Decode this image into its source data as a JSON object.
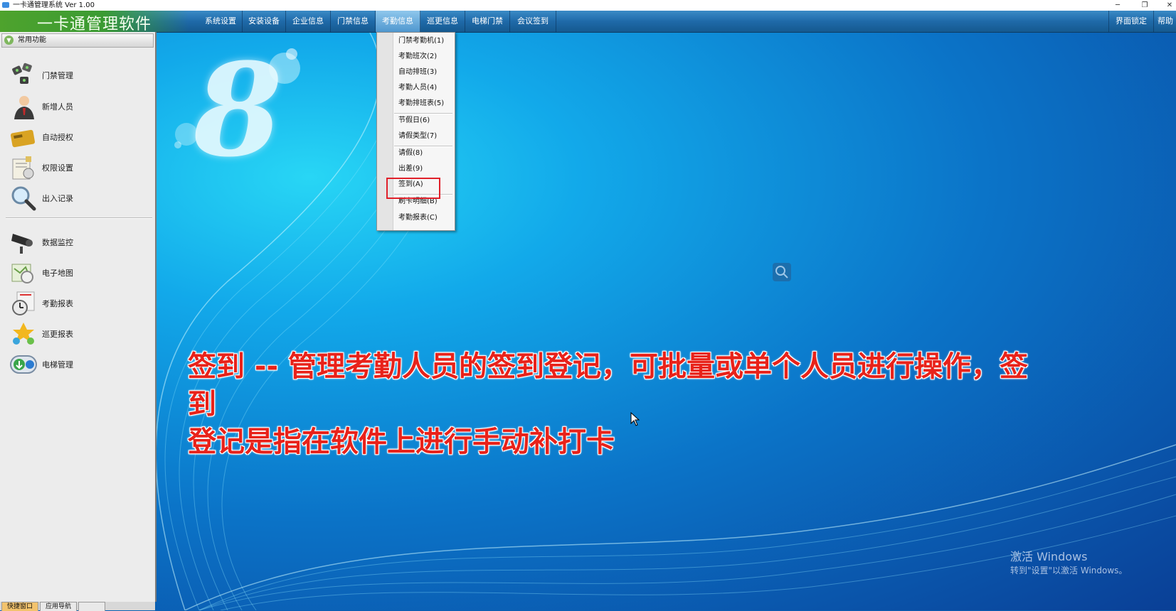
{
  "window": {
    "title": "一卡通管理系统  Ver 1.00",
    "controls": [
      "─",
      "❐",
      "✕"
    ]
  },
  "menubar": {
    "brand": "一卡通管理软件",
    "items": [
      "系统设置",
      "安装设备",
      "企业信息",
      "门禁信息",
      "考勤信息",
      "巡更信息",
      "电梯门禁",
      "会议签到"
    ],
    "active_item": "考勤信息",
    "right_items": [
      "界面锁定",
      "帮助"
    ]
  },
  "sidebar": {
    "header": "常用功能",
    "group1": [
      {
        "label": "门禁管理",
        "icon": "door-access-icon"
      },
      {
        "label": "新增人员",
        "icon": "person-icon"
      },
      {
        "label": "自动授权",
        "icon": "card-icon"
      },
      {
        "label": "权限设置",
        "icon": "permission-icon"
      },
      {
        "label": "出入记录",
        "icon": "magnifier-icon"
      }
    ],
    "group2": [
      {
        "label": "数据监控",
        "icon": "camera-icon"
      },
      {
        "label": "电子地图",
        "icon": "map-icon"
      },
      {
        "label": "考勤报表",
        "icon": "clock-icon"
      },
      {
        "label": "巡更报表",
        "icon": "patrol-icon"
      },
      {
        "label": "电梯管理",
        "icon": "elevator-icon"
      }
    ]
  },
  "bottom_tabs": [
    "快捷窗口",
    "应用导航"
  ],
  "dropdown": {
    "items": [
      {
        "label": "门禁考勤机(1)"
      },
      {
        "label": "考勤班次(2)"
      },
      {
        "label": "自动排班(3)"
      },
      {
        "label": "考勤人员(4)"
      },
      {
        "label": "考勤排班表(5)"
      },
      {
        "label": "节假日(6)"
      },
      {
        "label": "请假类型(7)"
      },
      {
        "label": "请假(8)"
      },
      {
        "label": "出差(9)"
      },
      {
        "label": "签到(A)"
      },
      {
        "label": "刷卡明细(B)"
      },
      {
        "label": "考勤报表(C)"
      }
    ],
    "highlighted": "签到(A)",
    "highlight_color": "#e0202a"
  },
  "main": {
    "logo": "8",
    "caption_line1": "签到 -- 管理考勤人员的签到登记，可批量或单个人员进行操作，签到",
    "caption_line2": "登记是指在软件上进行手动补打卡",
    "caption_color": "#e8221a",
    "activation_line1": "激活 Windows",
    "activation_line2": "转到\"设置\"以激活 Windows。"
  }
}
